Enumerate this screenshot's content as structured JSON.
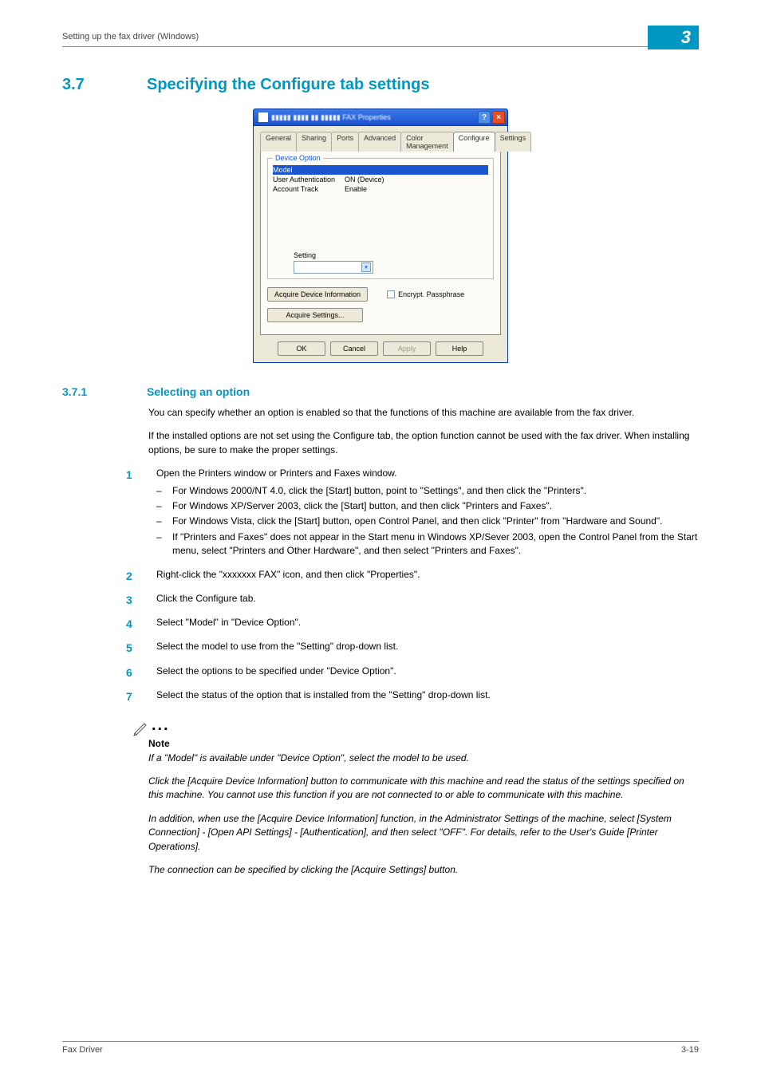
{
  "header": {
    "running_head": "Setting up the fax driver (Windows)",
    "chapter_number": "3"
  },
  "section": {
    "number": "3.7",
    "title": "Specifying the Configure tab settings"
  },
  "dialog": {
    "title": "FAX Properties",
    "help_glyph": "?",
    "close_glyph": "×",
    "tabs": [
      "General",
      "Sharing",
      "Ports",
      "Advanced",
      "Color Management",
      "Configure",
      "Settings"
    ],
    "active_tab": "Configure",
    "group_label": "Device Option",
    "device_options": [
      {
        "k": "Model",
        "v": ""
      },
      {
        "k": "User Authentication",
        "v": "ON (Device)"
      },
      {
        "k": "Account Track",
        "v": "Enable"
      }
    ],
    "setting_label": "Setting",
    "buttons": {
      "acquire_info": "Acquire Device Information",
      "acquire_settings": "Acquire Settings...",
      "encrypt_label": "Encrypt. Passphrase",
      "ok": "OK",
      "cancel": "Cancel",
      "apply": "Apply",
      "help": "Help"
    }
  },
  "subsection": {
    "number": "3.7.1",
    "title": "Selecting an option",
    "intro1": "You can specify whether an option is enabled so that the functions of this machine are available from the fax driver.",
    "intro2": "If the installed options are not set using the Configure tab, the option function cannot be used with the fax driver. When installing options, be sure to make the proper settings."
  },
  "steps": [
    {
      "n": "1",
      "text": "Open the Printers window or Printers and Faxes window.",
      "subs": [
        "For Windows 2000/NT 4.0, click the [Start] button, point to \"Settings\", and then click the \"Printers\".",
        "For Windows XP/Server 2003, click the [Start] button, and then click \"Printers and Faxes\".",
        "For Windows Vista, click the [Start] button, open Control Panel, and then click \"Printer\" from \"Hardware and Sound\".",
        "If \"Printers and Faxes\" does not appear in the Start menu in Windows XP/Sever 2003, open the Control Panel from the Start menu, select \"Printers and Other Hardware\", and then select \"Printers and Faxes\"."
      ]
    },
    {
      "n": "2",
      "text": "Right-click the \"xxxxxxx FAX\" icon, and then click \"Properties\"."
    },
    {
      "n": "3",
      "text": "Click the Configure tab."
    },
    {
      "n": "4",
      "text": "Select \"Model\" in \"Device Option\"."
    },
    {
      "n": "5",
      "text": "Select the model to use from the \"Setting\" drop-down list."
    },
    {
      "n": "6",
      "text": "Select the options to be specified under \"Device Option\"."
    },
    {
      "n": "7",
      "text": "Select the status of the option that is installed from the \"Setting\" drop-down list."
    }
  ],
  "note": {
    "label": "Note",
    "paras": [
      "If a \"Model\" is available under \"Device Option\", select the model to be used.",
      "Click the [Acquire Device Information] button to communicate with this machine and read the status of the settings specified on this machine. You cannot use this function if you are not connected to or able to communicate with this machine.",
      "In addition, when use the [Acquire Device Information] function, in the Administrator Settings of the machine, select [System Connection] - [Open API Settings] - [Authentication], and then select \"OFF\". For details, refer to the User's Guide [Printer Operations].",
      "The connection can be specified by clicking the [Acquire Settings] button."
    ]
  },
  "footer": {
    "left": "Fax Driver",
    "right": "3-19"
  }
}
